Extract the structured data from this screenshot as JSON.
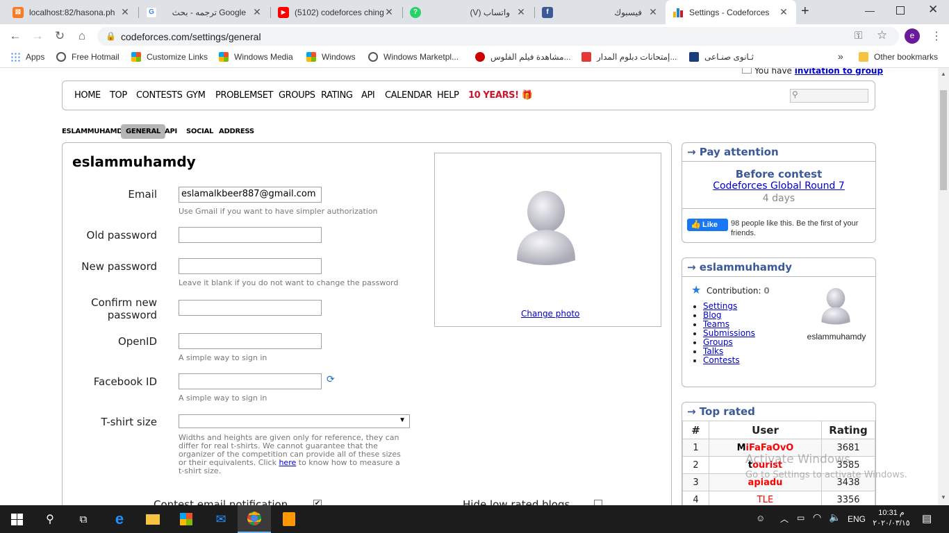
{
  "tabs": [
    {
      "title": "localhost:82/hasona.ph",
      "fav": "xampp-icon",
      "color": "#fb7a24"
    },
    {
      "title": "ترجمه - بحث Google",
      "fav": "google-icon",
      "color": "#4285f4"
    },
    {
      "title": "(5102) codeforces ching",
      "fav": "youtube-icon",
      "color": "#ff0000"
    },
    {
      "title": "(V) واتساب",
      "fav": "whatsapp-icon",
      "color": "#25d366"
    },
    {
      "title": "فيسبوك",
      "fav": "facebook-icon",
      "color": "#3b5998"
    },
    {
      "title": "Settings - Codeforces",
      "fav": "codeforces-icon",
      "color": "#1f8acb"
    }
  ],
  "url": "codeforces.com/settings/general",
  "profile_initial": "e",
  "bookmarks": [
    "Apps",
    "Free Hotmail",
    "Customize Links",
    "Windows Media",
    "Windows",
    "Windows Marketpl...",
    "مشاهدة فيلم الفلوس...",
    "إمتحانات دبلوم المدار...",
    "ثـانوى صنـاعى"
  ],
  "bookmarks_more": "»",
  "other_bookmarks": "Other bookmarks",
  "invitation": {
    "text": "You have",
    "link": "invitation to group"
  },
  "menu": [
    "HOME",
    "TOP",
    "CONTESTS",
    "GYM",
    "PROBLEMSET",
    "GROUPS",
    "RATING",
    "API",
    "CALENDAR",
    "HELP",
    "10 YEARS! 🎁"
  ],
  "menu_highlight_color": "#d0142c",
  "subtabs": [
    "ESLAMMUHAMDY",
    "GENERAL",
    "API",
    "SOCIAL",
    "ADDRESS"
  ],
  "handle": "eslammuhamdy",
  "form": {
    "email_label": "Email",
    "email_value": "eslamalkbeer887@gmail.com",
    "email_hint": "Use Gmail if you want to have simpler authorization",
    "old_label": "Old password",
    "new_label": "New password",
    "new_hint": "Leave it blank if you do not want to change the password",
    "confirm_label_1": "Confirm new",
    "confirm_label_2": "password",
    "openid_label": "OpenID",
    "openid_hint": "A simple way to sign in",
    "fb_label": "Facebook ID",
    "fb_hint": "A simple way to sign in",
    "tshirt_label": "T-shirt size",
    "tshirt_hint_1": "Widths and heights are given only for reference, they can",
    "tshirt_hint_2": "differ for real t-shirts. We cannot guarantee that the",
    "tshirt_hint_3": "organizer of the competition can provide all of these sizes",
    "tshirt_hint_4": "or their equivalents. Click",
    "tshirt_hint_link": "here",
    "tshirt_hint_5": "to know how to measure a",
    "tshirt_hint_6": "t-shirt size.",
    "contest_email": "Contest email notification",
    "hide_low": "Hide low rated blogs"
  },
  "change_photo": "Change photo",
  "pay": {
    "title": "→ Pay attention",
    "before": "Before contest",
    "contest": "Codeforces Global Round 7",
    "days": "4 days",
    "like": "Like",
    "like_text_1": "98 people like this. Be the first of your",
    "like_text_2": "friends."
  },
  "user_box": {
    "title": "→ eslammuhamdy",
    "contribution_label": "Contribution:",
    "contribution_value": "0",
    "links": [
      "Settings",
      "Blog",
      "Teams",
      "Submissions",
      "Groups",
      "Talks",
      "Contests"
    ],
    "avatar_name": "eslammuhamdy"
  },
  "top_rated": {
    "title": "→ Top rated",
    "headers": [
      "#",
      "User",
      "Rating"
    ],
    "rows": [
      {
        "rank": "1",
        "first": "M",
        "rest": "iFaFaOvO",
        "rating": "3681"
      },
      {
        "rank": "2",
        "first": "t",
        "rest": "ourist",
        "rating": "3585"
      },
      {
        "rank": "3",
        "first": "a",
        "rest": "piadu",
        "rating": "3438"
      },
      {
        "rank": "4",
        "first": "T",
        "rest": "LE",
        "rating": "3356"
      }
    ]
  },
  "watermark": {
    "line1": "Activate Windows",
    "line2": "Go to Settings to activate Windows."
  },
  "taskbar": {
    "lang": "ENG",
    "time": "10:31 م",
    "date": "٢٠٢٠/٠٣/١٥"
  }
}
